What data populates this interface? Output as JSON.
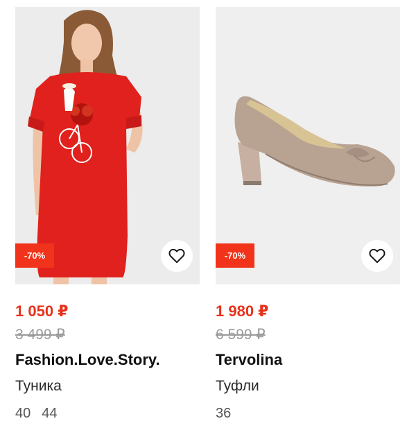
{
  "products": [
    {
      "discount_badge": "-70%",
      "price": "1 050 ₽",
      "old_price": "3 499 ₽",
      "brand": "Fashion.Love.Story.",
      "type": "Туника",
      "sizes": [
        "40",
        "44"
      ],
      "image_icon": "red-dress-photo",
      "favorite_icon": "heart-icon"
    },
    {
      "discount_badge": "-70%",
      "price": "1 980 ₽",
      "old_price": "6 599 ₽",
      "brand": "Tervolina",
      "type": "Туфли",
      "sizes": [
        "36"
      ],
      "image_icon": "beige-shoe-photo",
      "favorite_icon": "heart-icon"
    }
  ],
  "colors": {
    "price": "#e8321a",
    "badge": "#f0331a",
    "dress": "#e0211d",
    "shoe": "#b8a292"
  }
}
